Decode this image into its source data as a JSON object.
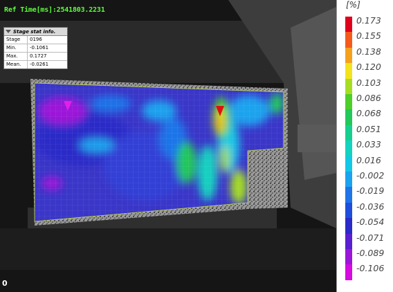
{
  "overlay": {
    "ref_time": "Ref Time[ms]:2541803.2231",
    "frame_index": "0"
  },
  "stat_panel": {
    "title": "Stage stat info.",
    "rows": [
      {
        "label": "Stage",
        "value": "0196"
      },
      {
        "label": "Min.",
        "value": "-0.1061"
      },
      {
        "label": "Max.",
        "value": "0.1727"
      },
      {
        "label": "Mean.",
        "value": "-0.0261"
      }
    ]
  },
  "legend": {
    "unit": "[%]",
    "entries": [
      {
        "value": "0.173",
        "color": "#e0001c"
      },
      {
        "value": "0.155",
        "color": "#f55a1c"
      },
      {
        "value": "0.138",
        "color": "#f5a11c"
      },
      {
        "value": "0.120",
        "color": "#f3e31c"
      },
      {
        "value": "0.103",
        "color": "#a6dd22"
      },
      {
        "value": "0.086",
        "color": "#4dce28"
      },
      {
        "value": "0.068",
        "color": "#22c85a"
      },
      {
        "value": "0.051",
        "color": "#16cf8e"
      },
      {
        "value": "0.033",
        "color": "#12d2c0"
      },
      {
        "value": "0.016",
        "color": "#12c8e6"
      },
      {
        "value": "-0.002",
        "color": "#1aa3ee"
      },
      {
        "value": "-0.019",
        "color": "#1f74e8"
      },
      {
        "value": "-0.036",
        "color": "#1f4ddc"
      },
      {
        "value": "-0.054",
        "color": "#2a2bc8"
      },
      {
        "value": "-0.071",
        "color": "#5a1fd0"
      },
      {
        "value": "-0.089",
        "color": "#9b16d8"
      },
      {
        "value": "-0.106",
        "color": "#d70adf"
      }
    ]
  },
  "markers": [
    {
      "name": "min-marker",
      "color": "#e020e8"
    },
    {
      "name": "max-marker",
      "color": "#e01010"
    }
  ]
}
